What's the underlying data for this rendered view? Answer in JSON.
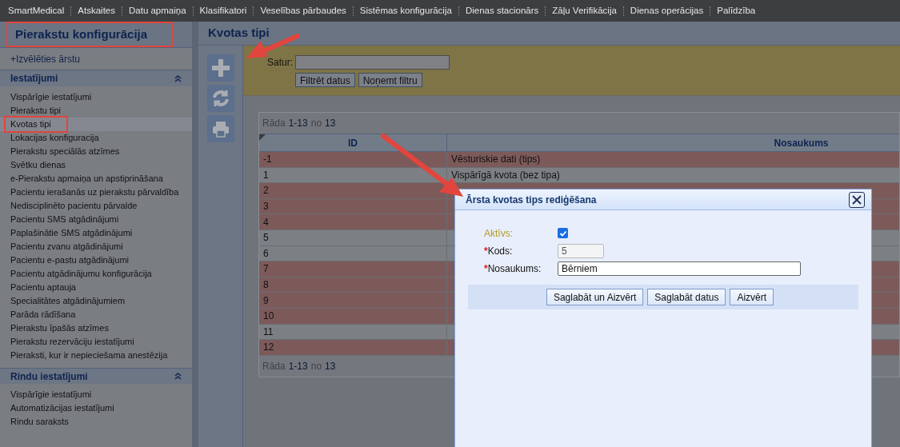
{
  "menu": [
    "SmartMedical",
    "Atskaites",
    "Datu apmaiņa",
    "Klasifikatori",
    "Veselības pārbaudes",
    "Sistēmas konfigurācija",
    "Dienas stacionārs",
    "Zāļu Verifikācija",
    "Dienas operācijas",
    "Palīdzība"
  ],
  "sidebar": {
    "title": "Pierakstu konfigurācija",
    "title_annotated": true,
    "choose_doctor": "+Izvēlēties ārstu",
    "sections": [
      {
        "title": "Iestatījumi",
        "expanded": true,
        "items": [
          {
            "label": "Vispārīgie iestatījumi",
            "selected": false,
            "annotated": false
          },
          {
            "label": "Pierakstu tipi",
            "selected": false,
            "annotated": false
          },
          {
            "label": "Kvotas tipi",
            "selected": true,
            "annotated": true
          },
          {
            "label": "Lokacijas konfiguracija",
            "selected": false,
            "annotated": false
          },
          {
            "label": "Pierakstu speciālās atzīmes",
            "selected": false,
            "annotated": false
          },
          {
            "label": "Svētku dienas",
            "selected": false,
            "annotated": false
          },
          {
            "label": "e-Pierakstu apmaiņa un apstiprināšana",
            "selected": false,
            "annotated": false
          },
          {
            "label": "Pacientu ierašanās uz pierakstu pārvaldība",
            "selected": false,
            "annotated": false
          },
          {
            "label": "Nedisciplinēto pacientu pārvalde",
            "selected": false,
            "annotated": false
          },
          {
            "label": "Pacientu SMS atgādinājumi",
            "selected": false,
            "annotated": false
          },
          {
            "label": "Paplašinātie SMS atgādinājumi",
            "selected": false,
            "annotated": false
          },
          {
            "label": "Pacientu zvanu atgādinājumi",
            "selected": false,
            "annotated": false
          },
          {
            "label": "Pacientu e-pastu atgādinājumi",
            "selected": false,
            "annotated": false
          },
          {
            "label": "Pacientu atgādinājumu konfigurācija",
            "selected": false,
            "annotated": false
          },
          {
            "label": "Pacientu aptauja",
            "selected": false,
            "annotated": false
          },
          {
            "label": "Specialitātes atgādinājumiem",
            "selected": false,
            "annotated": false
          },
          {
            "label": "Parāda rādīšana",
            "selected": false,
            "annotated": false
          },
          {
            "label": "Pierakstu īpašās atzīmes",
            "selected": false,
            "annotated": false
          },
          {
            "label": "Pierakstu rezervāciju iestatījumi",
            "selected": false,
            "annotated": false
          },
          {
            "label": "Pieraksti, kur ir nepieciešama anestēzija",
            "selected": false,
            "annotated": false
          }
        ]
      },
      {
        "title": "Rindu iestatījumi",
        "expanded": true,
        "items": [
          {
            "label": "Vispārīgie iestatījumi",
            "selected": false,
            "annotated": false
          },
          {
            "label": "Automatizācijas iestatījumi",
            "selected": false,
            "annotated": false
          },
          {
            "label": "Rindu saraksts",
            "selected": false,
            "annotated": false
          }
        ]
      }
    ]
  },
  "main": {
    "title": "Kvotas tipi",
    "filter": {
      "label": "Satur:",
      "buttons": [
        "Filtrēt datus",
        "Noņemt filtru"
      ]
    },
    "pager_top": {
      "prefix": "Rāda",
      "range": "1-13",
      "of": "no",
      "total": "13"
    },
    "pager_bottom": {
      "prefix": "Rāda",
      "range": "1-13",
      "of": "no",
      "total": "13"
    },
    "table": {
      "columns": [
        "ID",
        "Nosaukums"
      ],
      "rows": [
        {
          "id": "-1",
          "name": "Vēsturiskie dati (tips)",
          "inactive": true
        },
        {
          "id": "1",
          "name": "Vispārīgā kvota (bez tipa)",
          "inactive": false
        },
        {
          "id": "2",
          "inactive": true
        },
        {
          "id": "3",
          "inactive": true
        },
        {
          "id": "4",
          "inactive": true
        },
        {
          "id": "5",
          "inactive": false
        },
        {
          "id": "6",
          "inactive": false
        },
        {
          "id": "7",
          "inactive": true
        },
        {
          "id": "8",
          "inactive": true
        },
        {
          "id": "9",
          "inactive": true
        },
        {
          "id": "10",
          "inactive": true
        },
        {
          "id": "11",
          "inactive": false
        },
        {
          "id": "12",
          "inactive": true
        }
      ]
    }
  },
  "dialog": {
    "title": "Ārsta kvotas tips rediģēšana",
    "fields": [
      {
        "kind": "checkbox",
        "label": "Aktīvs:",
        "checked": true
      },
      {
        "kind": "text",
        "required_mark": "*",
        "label": "Kods:",
        "value": "5",
        "disabled": true
      },
      {
        "kind": "text",
        "required_mark": "*",
        "label": "Nosaukums:",
        "value": "Bērniem",
        "disabled": false
      }
    ],
    "buttons": [
      "Saglabāt un Aizvērt",
      "Saglabāt datus",
      "Aizvērt"
    ]
  }
}
